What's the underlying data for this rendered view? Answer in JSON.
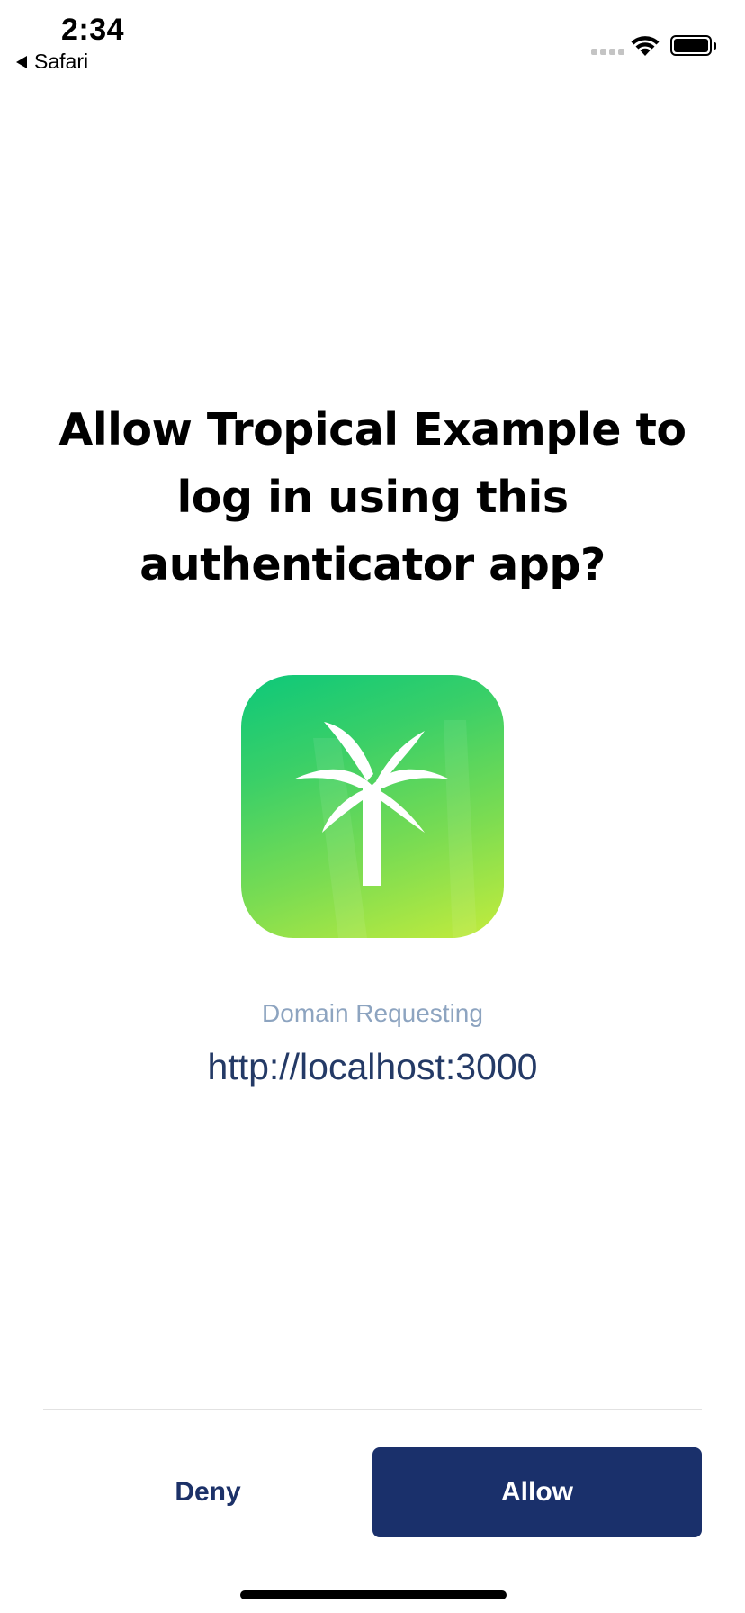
{
  "status_bar": {
    "time": "2:34",
    "back_app": "Safari",
    "icons": [
      "signal-dots-icon",
      "wifi-icon",
      "battery-icon"
    ]
  },
  "prompt": {
    "title": "Allow Tropical Example to log in using this authenticator app?"
  },
  "app_icon": {
    "name": "palm-tree-icon",
    "colors": {
      "gradient_start": "#0dc87a",
      "gradient_end": "#c4ec3c",
      "glyph": "#ffffff"
    }
  },
  "domain": {
    "label": "Domain Requesting",
    "value": "http://localhost:3000"
  },
  "actions": {
    "deny_label": "Deny",
    "allow_label": "Allow"
  },
  "colors": {
    "primary": "#1a306b",
    "domain_label": "#8da4c0",
    "domain_value": "#243a66"
  }
}
